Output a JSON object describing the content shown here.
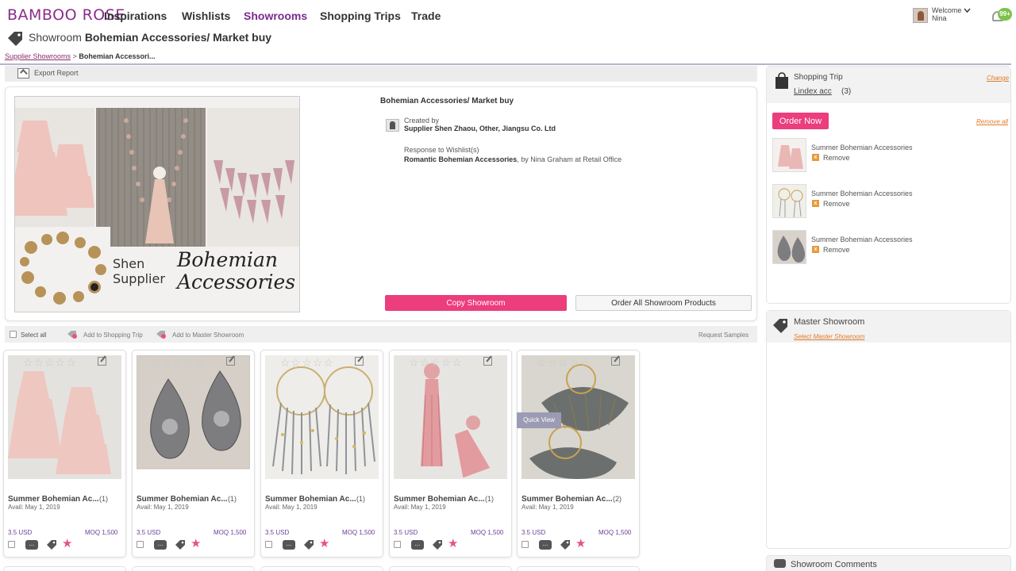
{
  "nav": {
    "logo": "BAMBOO ROSE",
    "items": [
      {
        "label": "Inspirations"
      },
      {
        "label": "Wishlists"
      },
      {
        "label": "Showrooms"
      },
      {
        "label": "Shopping Trips"
      },
      {
        "label": "Trade"
      }
    ],
    "active_item": "Showrooms",
    "welcome_label": "Welcome",
    "user_name": "Nina",
    "notification_count": "99+"
  },
  "page": {
    "title_prefix": "Showroom",
    "title_name": "Bohemian Accessories/ Market buy",
    "breadcrumb_link": "Supplier Showrooms",
    "breadcrumb_sep": ">",
    "breadcrumb_current": "Bohemian Accessori..."
  },
  "toolbar": {
    "export_label": "Export Report"
  },
  "showroom": {
    "title": "Bohemian Accessories/ Market buy",
    "created_by_label": "Created by",
    "creator": "Supplier Shen Zhaou, Other, Jiangsu Co. Ltd",
    "response_label": "Response to Wishlist(s)",
    "response_wishlist": "Romantic Bohemian Accessories",
    "response_detail": ", by Nina Graham at Retail Office",
    "cover_text_left_1": "Shen",
    "cover_text_left_2": "Supplier",
    "cover_text_right_1": "Bohemian",
    "cover_text_right_2": "Accessories",
    "copy_button": "Copy Showroom",
    "order_all_button": "Order All Showroom Products"
  },
  "select_bar": {
    "select_all": "Select all",
    "add_trip": "Add to Shopping Trip",
    "add_master": "Add to Master Showroom",
    "request_samples": "Request Samples"
  },
  "products": [
    {
      "name": "Summer Bohemian Ac...",
      "qty": "(1)",
      "avail": "Avail: May 1, 2019",
      "price": "3.5 USD",
      "moq": "MOQ  1,500"
    },
    {
      "name": "Summer Bohemian Ac...",
      "qty": "(1)",
      "avail": "Avail: May 1, 2019",
      "price": "3.5 USD",
      "moq": "MOQ  1,500"
    },
    {
      "name": "Summer Bohemian Ac...",
      "qty": "(1)",
      "avail": "Avail: May 1, 2019",
      "price": "3.5 USD",
      "moq": "MOQ  1,500"
    },
    {
      "name": "Summer Bohemian Ac...",
      "qty": "(1)",
      "avail": "Avail: May 1, 2019",
      "price": "3.5 USD",
      "moq": "MOQ  1,500"
    },
    {
      "name": "Summer Bohemian Ac...",
      "qty": "(2)",
      "avail": "Avail: May 1, 2019",
      "price": "3.5 USD",
      "moq": "MOQ  1,500"
    }
  ],
  "quick_view": "Quick View",
  "chat_glyph": "...",
  "star_rating_glyphs": "☆☆☆☆☆",
  "shopping_trip": {
    "title": "Shopping Trip",
    "name": "Lindex acc",
    "count": "(3)",
    "change": "Change",
    "order_now": "Order Now",
    "remove_all": "Remove all",
    "items": [
      {
        "name": "Summer Bohemian Accessories",
        "remove": "Remove"
      },
      {
        "name": "Summer Bohemian Accessories",
        "remove": "Remove"
      },
      {
        "name": "Summer Bohemian Accessories",
        "remove": "Remove"
      }
    ],
    "remove_glyph": "x"
  },
  "master_showroom": {
    "title": "Master Showroom",
    "select_link": "Select Master Showroom"
  },
  "comments": {
    "label": "Showroom Comments"
  },
  "colors": {
    "brand": "#8a2d8b",
    "accent_pink": "#ec3d7c",
    "link_orange": "#e07b2a",
    "price_purple": "#6a3f9a"
  }
}
